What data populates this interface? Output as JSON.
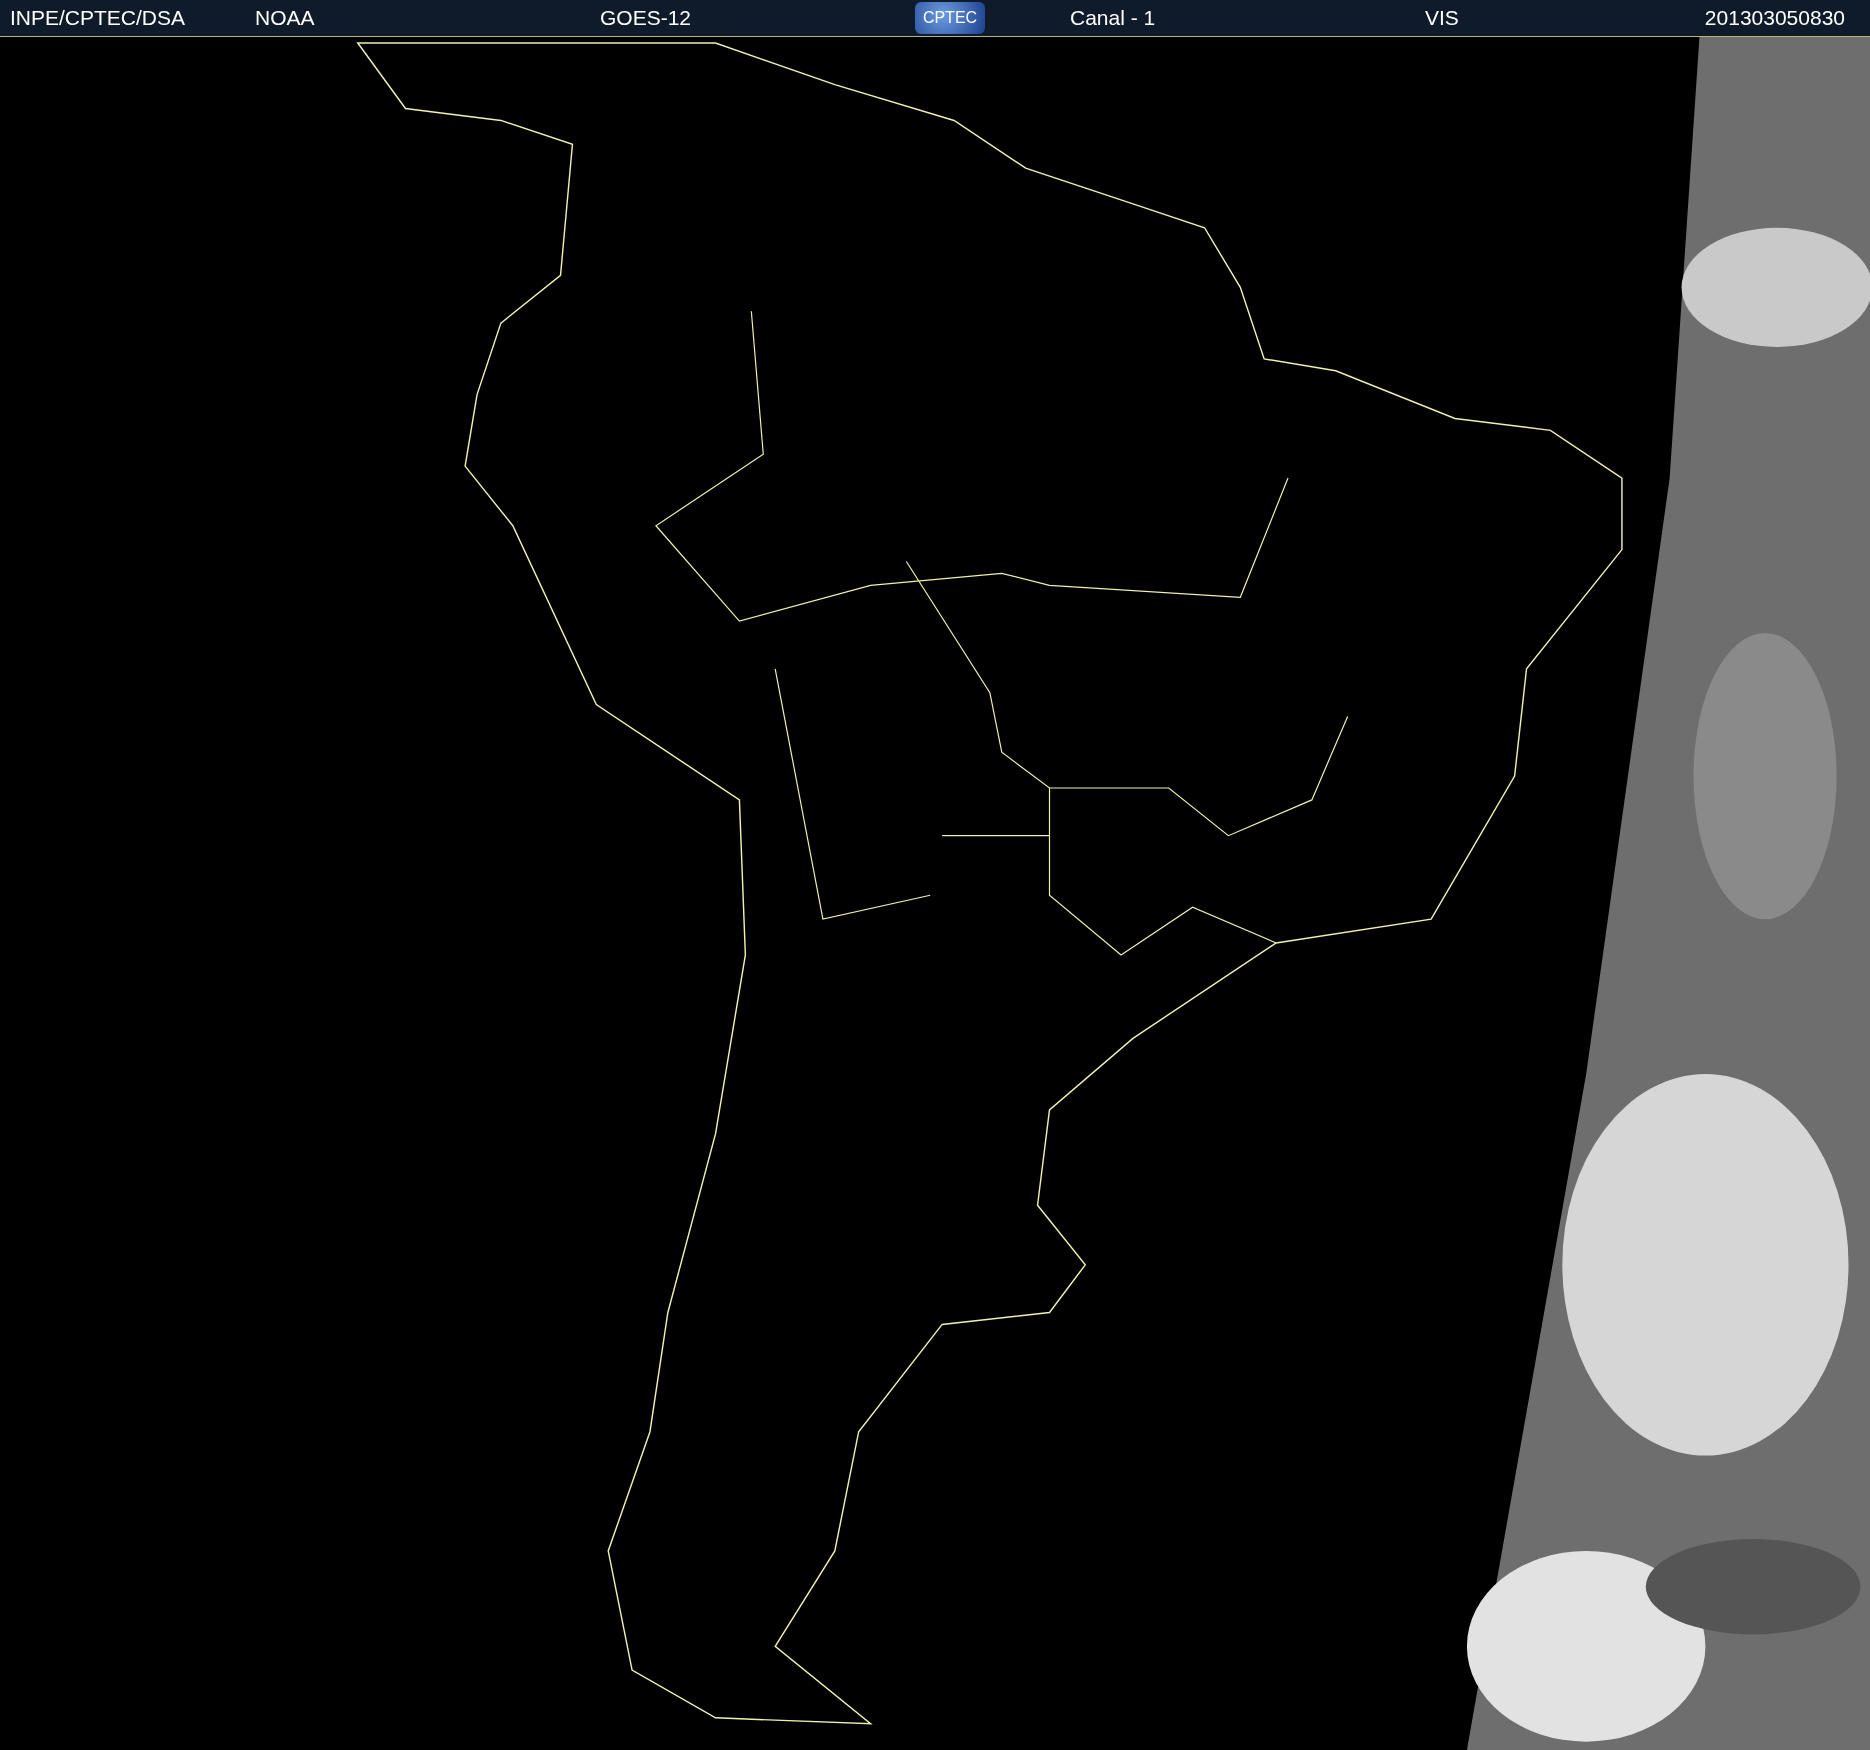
{
  "header": {
    "source": "INPE/CPTEC/DSA",
    "agency": "NOAA",
    "satellite": "GOES-12",
    "logo": "CPTEC",
    "channel": "Canal - 1",
    "band": "VIS",
    "timestamp": "201303050830"
  }
}
